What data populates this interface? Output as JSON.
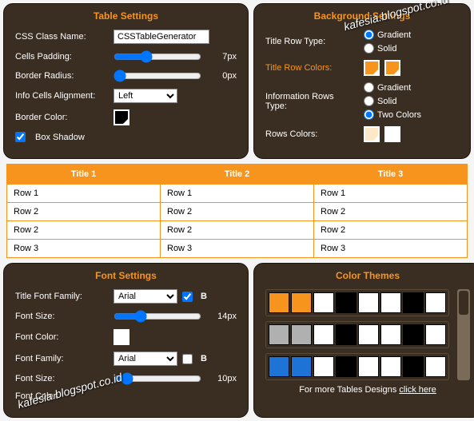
{
  "watermark": "kafesia.blogspot.co.id",
  "table_settings": {
    "title": "Table Settings",
    "css_class_label": "CSS Class Name:",
    "css_class_value": "CSSTableGenerator",
    "cells_padding_label": "Cells Padding:",
    "cells_padding_value": "7px",
    "border_radius_label": "Border Radius:",
    "border_radius_value": "0px",
    "info_align_label": "Info Cells Alignment:",
    "info_align_value": "Left",
    "border_color_label": "Border Color:",
    "box_shadow_label": "Box Shadow"
  },
  "background_settings": {
    "title": "Background Settings",
    "title_row_type_label": "Title Row Type:",
    "opt_gradient": "Gradient",
    "opt_solid": "Solid",
    "title_row_colors_label": "Title Row Colors:",
    "info_rows_type_label": "Information Rows Type:",
    "opt_two_colors": "Two Colors",
    "rows_colors_label": "Rows Colors:"
  },
  "preview": {
    "headers": [
      "Title 1",
      "Title 2",
      "Title 3"
    ],
    "rows": [
      [
        "Row 1",
        "Row 1",
        "Row 1"
      ],
      [
        "Row 2",
        "Row 2",
        "Row 2"
      ],
      [
        "Row 2",
        "Row 2",
        "Row 2"
      ],
      [
        "Row 3",
        "Row 3",
        "Row 3"
      ]
    ]
  },
  "font_settings": {
    "title": "Font Settings",
    "title_font_family_label": "Title Font Family:",
    "title_font_family_value": "Arial",
    "bold_b": "B",
    "font_size_label": "Font Size:",
    "font_size_value": "14px",
    "font_color_label": "Font Color:",
    "font_family2_label": "Font Family:",
    "font_family2_value": "Arial",
    "font_size2_value": "10px",
    "font_color2_label": "Font Color:"
  },
  "color_themes": {
    "title": "Color Themes",
    "rows": [
      [
        "#f7941d",
        "#f7941d",
        "#ffffff",
        "#000000",
        "#ffffff",
        "#ffffff",
        "#000000",
        "#ffffff"
      ],
      [
        "#b0b0b0",
        "#b0b0b0",
        "#ffffff",
        "#000000",
        "#ffffff",
        "#ffffff",
        "#000000",
        "#ffffff"
      ],
      [
        "#1e73d6",
        "#1e73d6",
        "#ffffff",
        "#000000",
        "#ffffff",
        "#ffffff",
        "#000000",
        "#ffffff"
      ]
    ],
    "link_text": "For more Tables Designs ",
    "link_cta": "click here"
  }
}
